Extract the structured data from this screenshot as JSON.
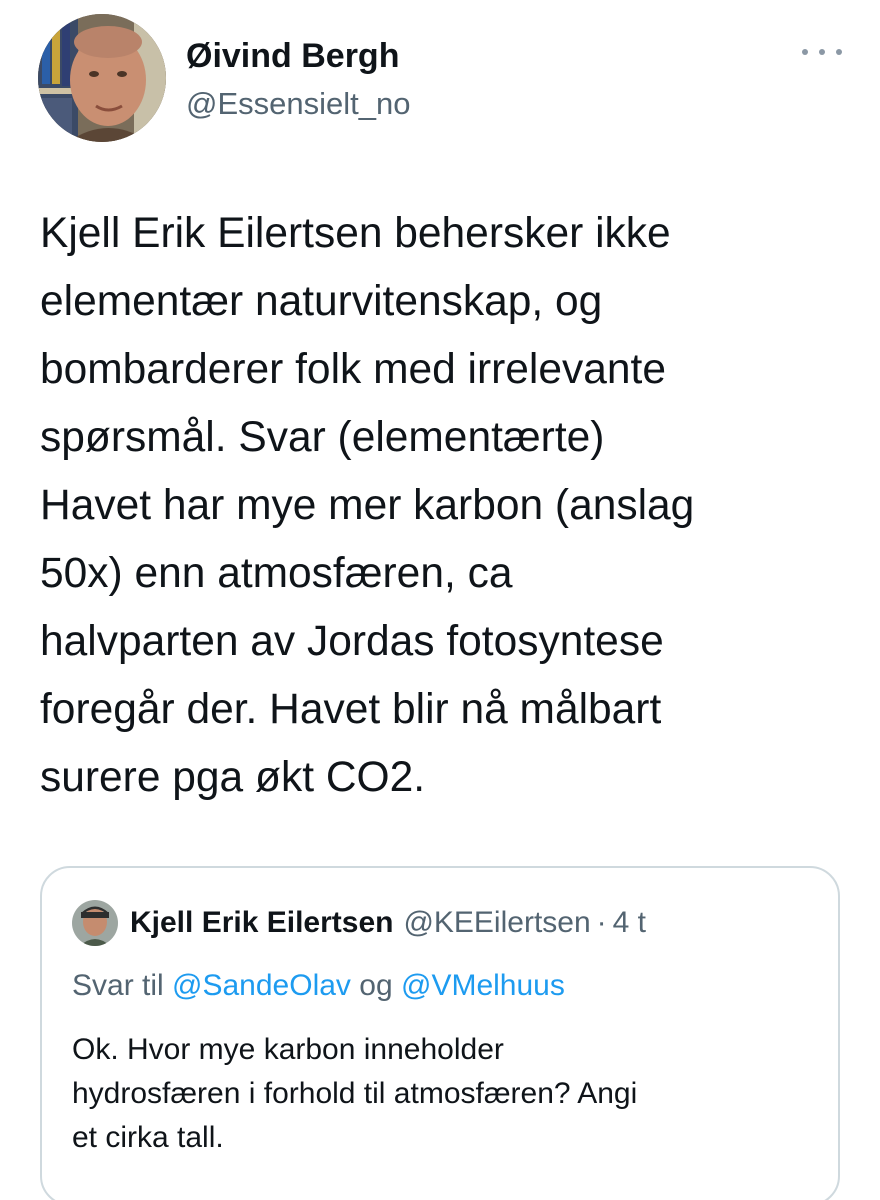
{
  "tweet": {
    "author": {
      "display_name": "Øivind Bergh",
      "handle": "@Essensielt_no"
    },
    "more_icon": "more-horizontal-icon",
    "text": "Kjell Erik Eilertsen behersker ikke\nelementær naturvitenskap, og\nbombarderer folk med irrelevante\nspørsmål. Svar (elementærte)\nHavet har mye mer karbon (anslag\n50x) enn atmosfæren, ca\nhalvparten av Jordas fotosyntese\nforegår der. Havet blir nå målbart\nsurere pga økt CO2."
  },
  "quoted_tweet": {
    "display_name": "Kjell Erik Eilertsen",
    "handle": "@KEEilertsen",
    "separator": "·",
    "time": "4 t",
    "reply_prefix": "Svar til",
    "reply_mentions": [
      "@SandeOlav",
      "@VMelhuus"
    ],
    "reply_conjunction": "og",
    "text": "Ok. Hvor mye karbon inneholder\nhydrosfæren i forhold til atmosfæren? Angi\net cirka tall."
  },
  "colors": {
    "text_primary": "#0f1419",
    "text_secondary": "#536471",
    "link": "#1d9bf0",
    "border": "#cfd9de"
  }
}
